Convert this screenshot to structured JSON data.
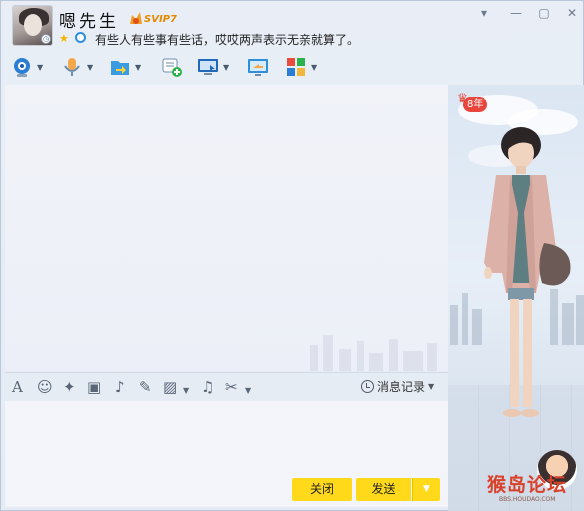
{
  "header": {
    "nickname": "嗯先生",
    "vip_label": "SVIP7",
    "signature": "有些人有些事有些话，哎哎两声表示无亲就算了。",
    "avatar_status": "◷"
  },
  "window_controls": [
    "▾",
    "—",
    "▢",
    "✕"
  ],
  "toolbar": {
    "items": [
      {
        "name": "video-call-icon",
        "color": "#2a7fd4"
      },
      {
        "name": "voice-call-icon",
        "color": "#6f8ca8"
      },
      {
        "name": "file-transfer-icon",
        "color": "#3a9be0"
      },
      {
        "name": "create-discussion-icon",
        "color": "#2bb24c"
      },
      {
        "name": "remote-desktop-icon",
        "color": "#2168b8"
      },
      {
        "name": "share-screen-icon",
        "color": "#2e8fd8"
      },
      {
        "name": "apps-icon",
        "color": "#e94b3c"
      }
    ]
  },
  "input_toolbar": {
    "font_glyph": "A",
    "emoji_glyph": "☺",
    "magic_glyph": "✦",
    "shake_glyph": "▣",
    "voice_glyph": "♪",
    "edit_glyph": "✎",
    "image_glyph": "▨",
    "music_glyph": "♫",
    "screenshot_glyph": "✂",
    "history_label": "消息记录"
  },
  "buttons": {
    "close_label": "关闭",
    "send_label": "发送",
    "send_dropdown": "▼"
  },
  "show_panel": {
    "year_badge": "8年"
  },
  "watermark": {
    "logo_text": "猴岛论坛",
    "sub_text": "BBS.HOUDAO.COM"
  }
}
